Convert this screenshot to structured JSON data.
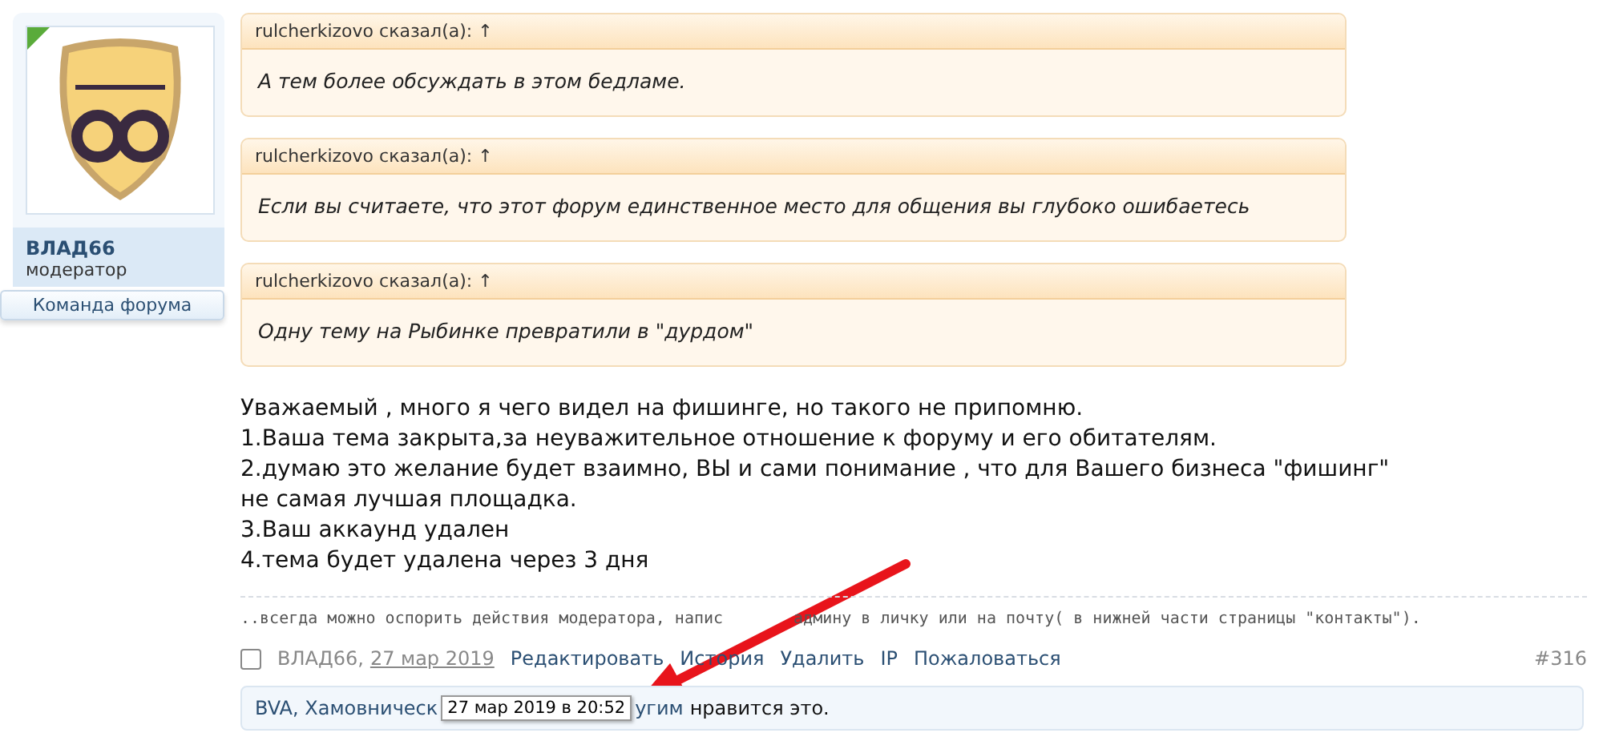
{
  "user": {
    "name": "ВЛАД66",
    "role": "модератор",
    "badge": "Команда форума"
  },
  "quotes": [
    {
      "author": "rulcherkizovo сказал(а): ↑",
      "text": "А тем более обсуждать в этом бедламе."
    },
    {
      "author": "rulcherkizovo сказал(а): ↑",
      "text": "Если вы считаете, что этот форум единственное место для общения вы глубоко ошибаетесь"
    },
    {
      "author": "rulcherkizovo сказал(а): ↑",
      "text": "Одну тему на Рыбинке превратили в \"дурдом\""
    }
  ],
  "message": [
    "Уважаемый , много я чего видел на фишинге, но такого не припомню.",
    "1.Ваша тема закрыта,за неуважительное отношение к форуму и его обитателям.",
    "2.думаю это желание будет взаимно, ВЫ и сами понимание , что для Вашего бизнеса \"фишинг\" не самая лучшая площадка.",
    "3.Ваш аккаунд удален",
    "4.тема будет удалена через 3 дня"
  ],
  "signature": [
    "..всегда можно оспорить действия модератора, напис",
    "админу в личку или на почту( в нижней части страницы \"контакты\")."
  ],
  "footer": {
    "checked": false,
    "author": "ВЛАД66,",
    "date": "27 мар 2019",
    "actions": [
      "Редактировать",
      "История",
      "Удалить",
      "IP",
      "Пожаловаться"
    ],
    "post_number": "#316"
  },
  "likes": {
    "names": "BVA, Хамовническ",
    "tooltip": "27 мар 2019 в 20:52",
    "others": "угим",
    "tail": "нравится это."
  }
}
